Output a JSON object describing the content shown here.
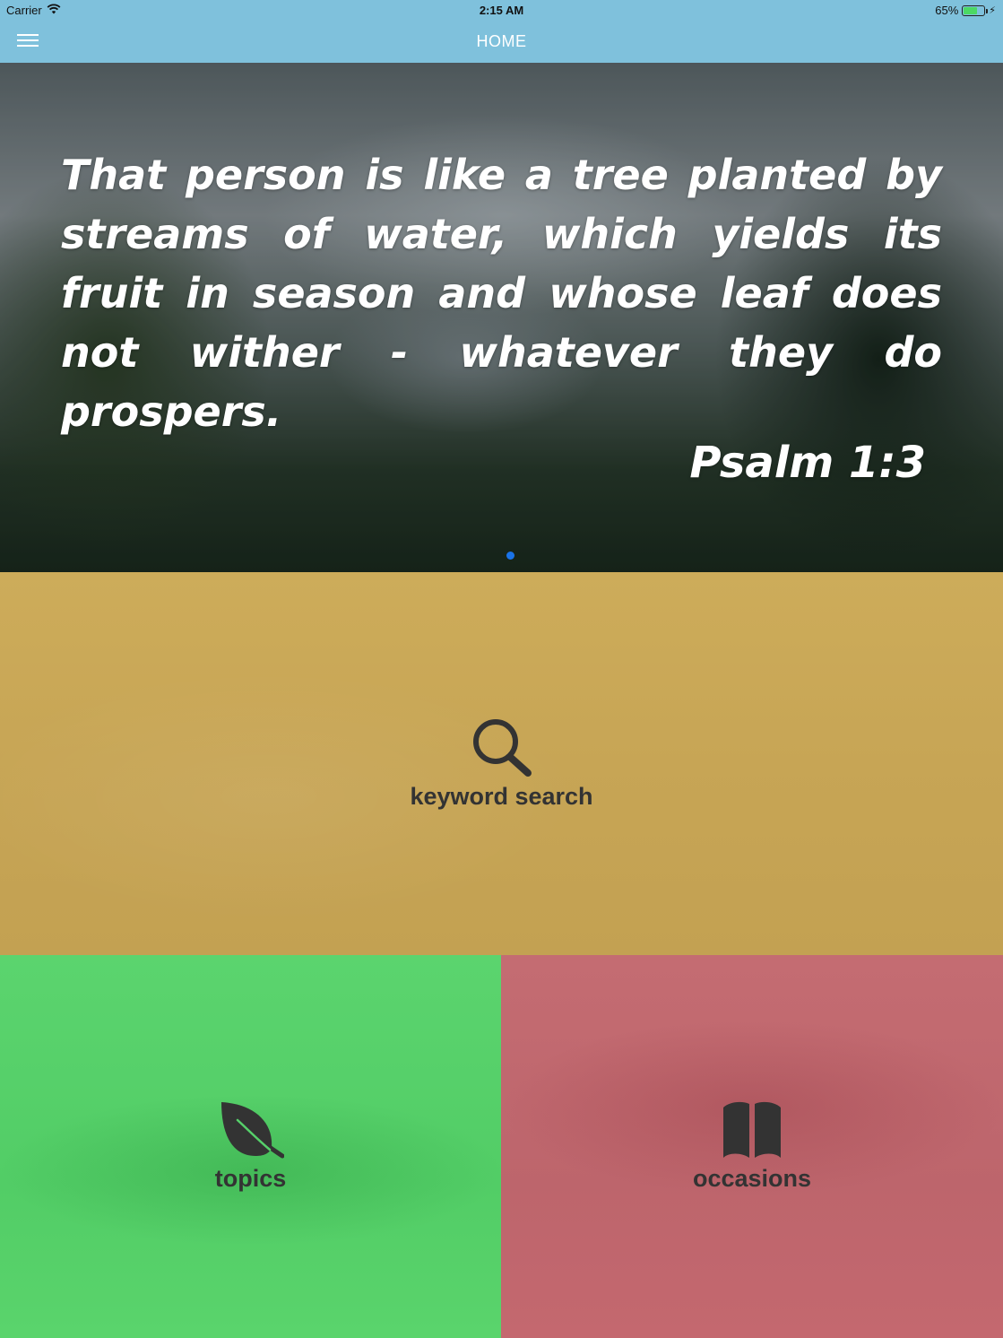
{
  "status_bar": {
    "carrier": "Carrier",
    "time": "2:15 AM",
    "battery_percent": "65%",
    "battery_level": 0.65,
    "icons": [
      "wifi-icon",
      "battery-icon",
      "charging-bolt-icon"
    ]
  },
  "nav": {
    "title": "HOME",
    "menu_icon": "hamburger-menu-icon"
  },
  "hero": {
    "quote": "That person is like a tree planted by streams of water, which yields its fruit in season and whose leaf does not wither - whatever they do prospers.",
    "reference": "Psalm 1:3",
    "page_count": 1,
    "current_page": 1,
    "dot_color": "#1a73e8"
  },
  "tiles": {
    "search": {
      "label": "keyword search",
      "icon": "search-icon",
      "color": "#c8a656"
    },
    "topics": {
      "label": "topics",
      "icon": "leaf-icon",
      "color": "#56d06a"
    },
    "occasions": {
      "label": "occasions",
      "icon": "book-icon",
      "color": "#c0686e"
    }
  }
}
